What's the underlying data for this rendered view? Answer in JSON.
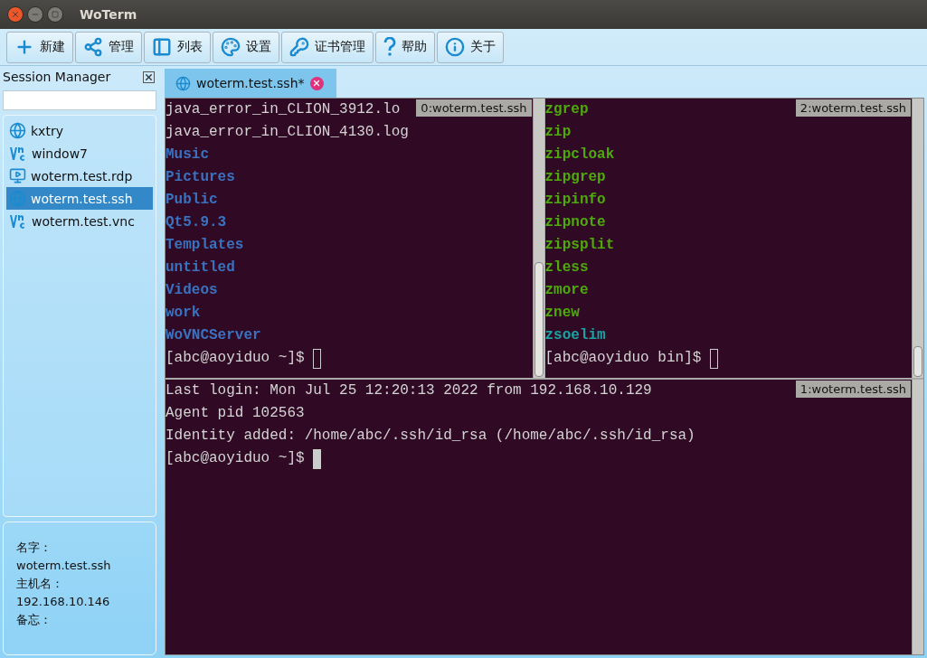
{
  "window": {
    "title": "WoTerm"
  },
  "toolbar": [
    {
      "label": "新建"
    },
    {
      "label": "管理"
    },
    {
      "label": "列表"
    },
    {
      "label": "设置"
    },
    {
      "label": "证书管理"
    },
    {
      "label": "帮助"
    },
    {
      "label": "关于"
    }
  ],
  "session_manager": {
    "title": "Session Manager",
    "items": [
      {
        "name": "kxtry",
        "kind": "ssh",
        "selected": false
      },
      {
        "name": "window7",
        "kind": "vnc",
        "selected": false
      },
      {
        "name": "woterm.test.rdp",
        "kind": "rdp",
        "selected": false
      },
      {
        "name": "woterm.test.ssh",
        "kind": "ssh",
        "selected": true
      },
      {
        "name": "woterm.test.vnc",
        "kind": "vnc",
        "selected": false
      }
    ],
    "info": [
      "名字：",
      "woterm.test.ssh",
      "主机名：",
      "192.168.10.146",
      "备忘："
    ]
  },
  "tabs": [
    {
      "label": "woterm.test.ssh*",
      "selected": true
    }
  ],
  "panes": [
    {
      "label": "0:woterm.test.ssh",
      "lines": [
        {
          "text": "java_error_in_CLION_3912.lo",
          "kind": "plain"
        },
        {
          "text": "java_error_in_CLION_4130.log",
          "kind": "plain"
        },
        {
          "text": "Music",
          "kind": "dir"
        },
        {
          "text": "Pictures",
          "kind": "dir"
        },
        {
          "text": "Public",
          "kind": "dir"
        },
        {
          "text": "Qt5.9.3",
          "kind": "dir"
        },
        {
          "text": "Templates",
          "kind": "dir"
        },
        {
          "text": "untitled",
          "kind": "dir"
        },
        {
          "text": "Videos",
          "kind": "dir"
        },
        {
          "text": "work",
          "kind": "dir"
        },
        {
          "text": "WoVNCServer",
          "kind": "dir"
        },
        {
          "text": "[abc@aoyiduo ~]$ ",
          "kind": "prompt",
          "focused": false
        }
      ]
    },
    {
      "label": "2:woterm.test.ssh",
      "lines": [
        {
          "text": "zgrep",
          "kind": "exec"
        },
        {
          "text": "zip",
          "kind": "exec"
        },
        {
          "text": "zipcloak",
          "kind": "exec"
        },
        {
          "text": "zipgrep",
          "kind": "exec"
        },
        {
          "text": "zipinfo",
          "kind": "exec"
        },
        {
          "text": "zipnote",
          "kind": "exec"
        },
        {
          "text": "zipsplit",
          "kind": "exec"
        },
        {
          "text": "zless",
          "kind": "exec"
        },
        {
          "text": "zmore",
          "kind": "exec"
        },
        {
          "text": "znew",
          "kind": "exec"
        },
        {
          "text": "zsoelim",
          "kind": "link"
        },
        {
          "text": "[abc@aoyiduo bin]$ ",
          "kind": "prompt",
          "focused": false
        }
      ]
    },
    {
      "label": "1:woterm.test.ssh",
      "lines": [
        {
          "text": "Last login: Mon Jul 25 12:20:13 2022 from 192.168.10.129",
          "kind": "plain"
        },
        {
          "text": "Agent pid 102563",
          "kind": "plain"
        },
        {
          "text": "Identity added: /home/abc/.ssh/id_rsa (/home/abc/.ssh/id_rsa)",
          "kind": "plain"
        },
        {
          "text": "[abc@aoyiduo ~]$ ",
          "kind": "prompt",
          "focused": true
        }
      ]
    }
  ]
}
